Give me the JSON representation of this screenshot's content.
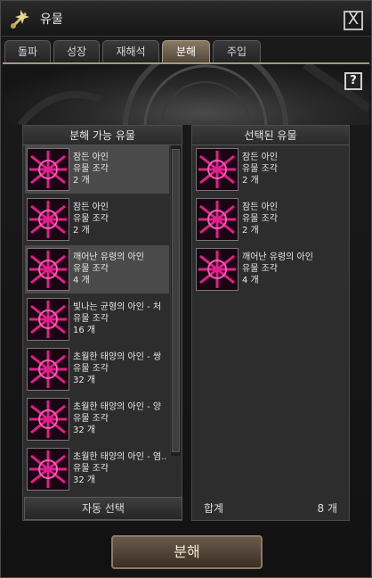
{
  "window": {
    "title": "유물",
    "close_label": "X"
  },
  "tabs": [
    {
      "label": "돌파",
      "active": false
    },
    {
      "label": "성장",
      "active": false
    },
    {
      "label": "재해석",
      "active": false
    },
    {
      "label": "분해",
      "active": true
    },
    {
      "label": "주입",
      "active": false
    }
  ],
  "help": {
    "label": "?"
  },
  "left_panel": {
    "title": "분해 가능 유물",
    "items": [
      {
        "name": "잠든 아인",
        "type": "유물 조각",
        "count": "2 개"
      },
      {
        "name": "잠든 아인",
        "type": "유물 조각",
        "count": "2 개"
      },
      {
        "name": "깨어난 유령의 아인",
        "type": "유물 조각",
        "count": "4 개"
      },
      {
        "name": "빛나는 균형의 아인 - 처",
        "type": "유물 조각",
        "count": "16 개"
      },
      {
        "name": "초월한 태양의 아인 - 쌍",
        "type": "유물 조각",
        "count": "32 개"
      },
      {
        "name": "초월한 태양의 아인 - 양",
        "type": "유물 조각",
        "count": "32 개"
      },
      {
        "name": "초월한 태양의 아인 - 염..",
        "type": "유물 조각",
        "count": "32 개"
      }
    ],
    "auto_select_label": "자동 선택"
  },
  "right_panel": {
    "title": "선택된 유물",
    "items": [
      {
        "name": "잠든 아인",
        "type": "유물 조각",
        "count": "2 개"
      },
      {
        "name": "잠든 아인",
        "type": "유물 조각",
        "count": "2 개"
      },
      {
        "name": "깨어난 유령의 아인",
        "type": "유물 조각",
        "count": "4 개"
      }
    ],
    "total_label": "합계",
    "total_value": "8 개"
  },
  "action": {
    "label": "분해"
  },
  "colors": {
    "accent": "#a89880",
    "icon_pink": "#e0208a"
  }
}
